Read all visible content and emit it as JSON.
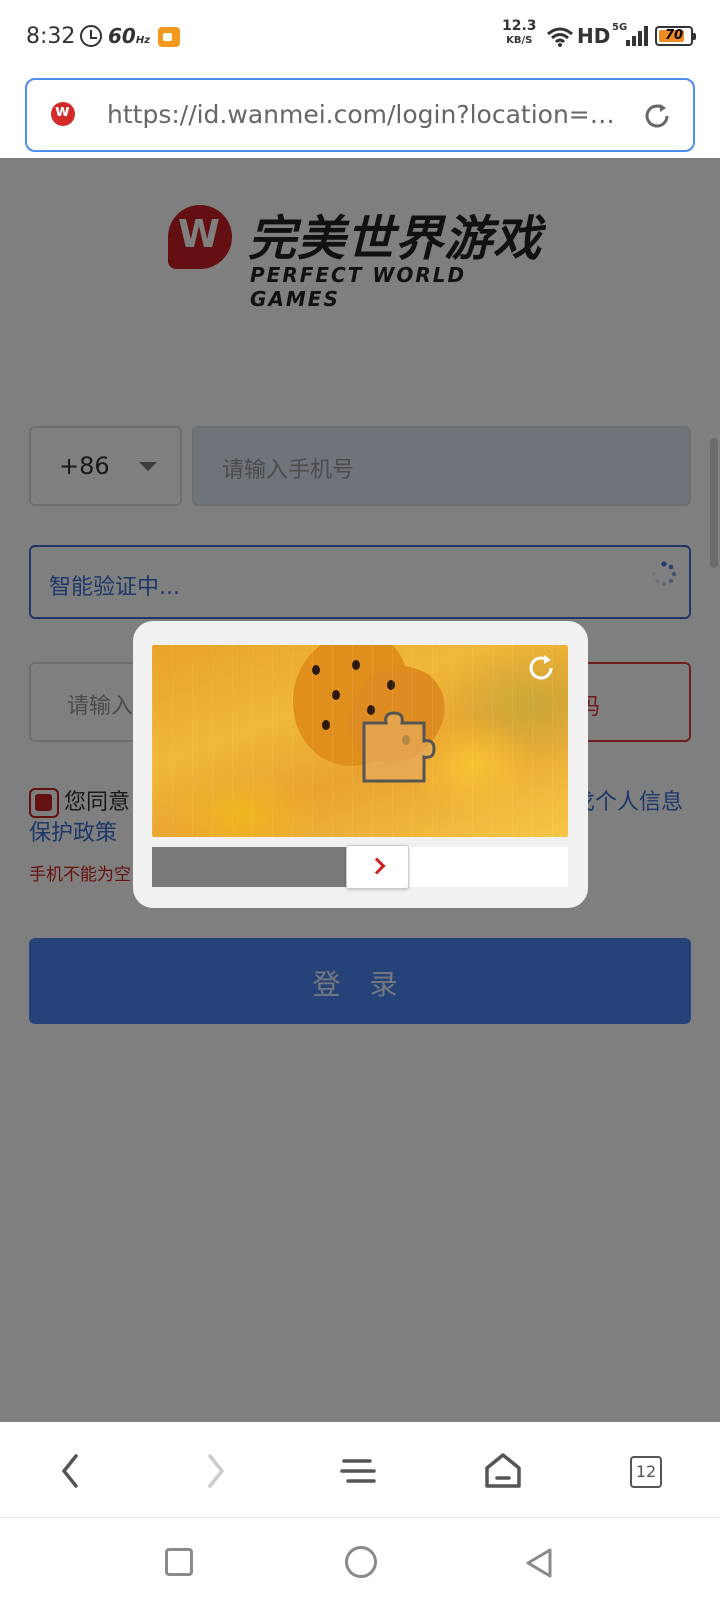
{
  "status_bar": {
    "time": "8:32",
    "refresh_rate": "60",
    "refresh_unit": "Hz",
    "net_speed_value": "12.3",
    "net_speed_unit": "KB/S",
    "hd_label": "HD",
    "network_type": "5G",
    "battery_level": "70",
    "icons": [
      "alarm-icon",
      "screen-record-icon",
      "wifi-icon",
      "signal-icon",
      "battery-icon"
    ]
  },
  "url_bar": {
    "url": "https://id.wanmei.com/login?location=h...",
    "favicon": "wanmei-favicon",
    "reload_icon": "reload-icon",
    "accent_color": "#4d8ef0"
  },
  "logo": {
    "chinese_name": "完美世界游戏",
    "english_name": "PERFECT WORLD GAMES",
    "brand_color": "#c81f25"
  },
  "form": {
    "country_code": "+86",
    "phone_placeholder": "请输入手机号",
    "smart_verify_text": "智能验证中...",
    "code_placeholder": "请输入",
    "get_code_button": "验证码",
    "agreement_prefix": "您同意",
    "agreement_link_right": "戈个人信息",
    "agreement_link_2": "保护政策",
    "error_text": "手机不能为空",
    "login_button": "登 录",
    "link_color": "#3b6fd4",
    "error_color": "#d21f1f"
  },
  "captcha": {
    "image": "butterfly-on-flowers",
    "refresh_icon": "refresh-icon",
    "puzzle_piece_icon": "puzzle-piece-icon",
    "slider_arrow_icon": "chevron-right-icon",
    "slider_progress": 0.47
  },
  "browser_nav": {
    "back_icon": "back-icon",
    "forward_icon": "forward-icon",
    "menu_icon": "menu-icon",
    "home_icon": "home-icon",
    "tabs_count": "12"
  },
  "system_nav": {
    "recents_icon": "recents-icon",
    "home_icon": "home-circle-icon",
    "back_icon": "back-triangle-icon"
  }
}
